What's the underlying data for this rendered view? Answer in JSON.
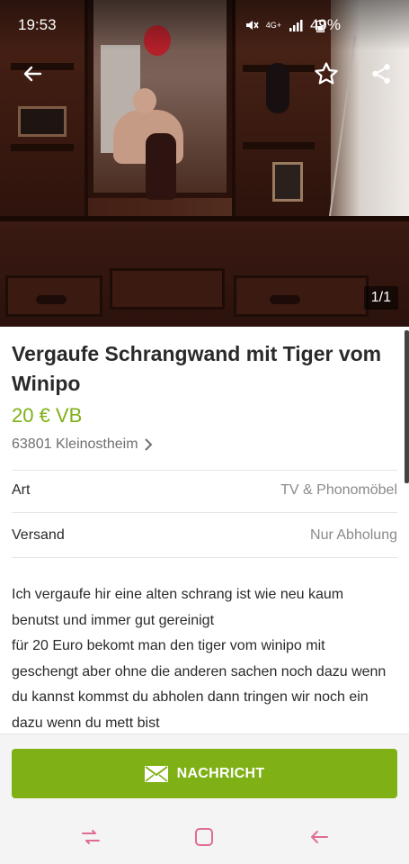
{
  "status_bar": {
    "time": "19:53",
    "network": "4G+",
    "battery": "49%"
  },
  "toolbar": {
    "back_icon": "arrow-left-icon",
    "favorite_icon": "star-outline-icon",
    "share_icon": "share-icon"
  },
  "gallery": {
    "counter": "1/1"
  },
  "listing": {
    "title": "Vergaufe Schrangwand mit Tiger vom Winipo",
    "price": "20 € VB",
    "location": "63801 Kleinostheim",
    "location_chevron": "›"
  },
  "attributes": [
    {
      "key": "Art",
      "value": "TV & Phonomöbel"
    },
    {
      "key": "Versand",
      "value": "Nur Abholung"
    }
  ],
  "description": "Ich vergaufe hir eine alten schrang ist wie neu kaum benutst und immer gut gereinigt\nfür 20 Euro bekomt man den tiger vom winipo mit geschengt aber ohne die anderen sachen noch dazu wenn du kannst kommst du abholen dann tringen wir noch ein dazu wenn du mett bist",
  "action": {
    "message_label": "NACHRICHT",
    "message_icon": "envelope-icon"
  },
  "colors": {
    "accent": "#7fb015",
    "nav_icon": "#e06d8f"
  },
  "system_nav": {
    "recent_icon": "recent-apps-icon",
    "home_icon": "home-icon",
    "back_icon": "back-icon"
  }
}
